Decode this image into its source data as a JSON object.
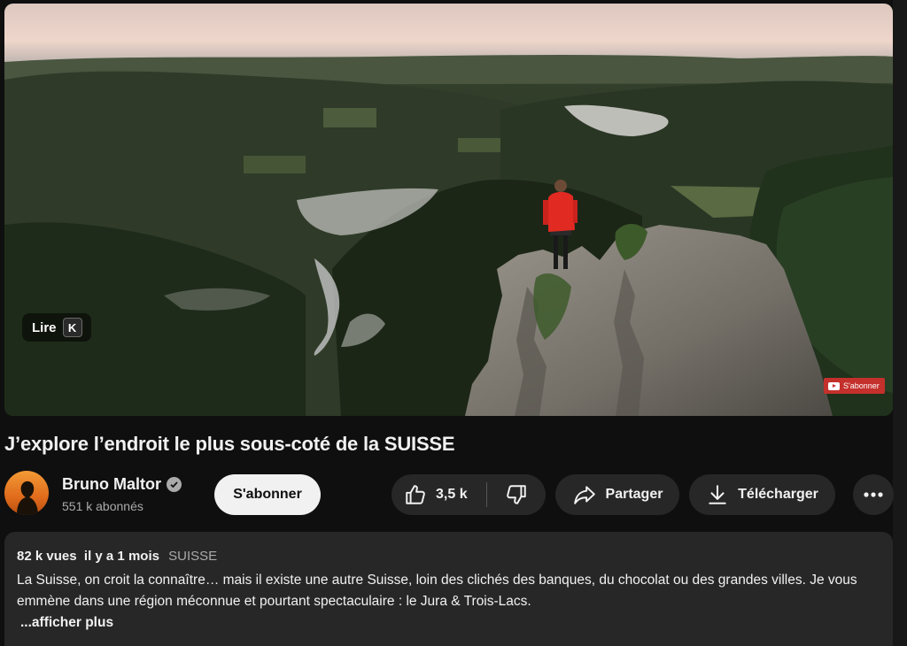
{
  "player": {
    "play_label": "Lire",
    "play_shortcut": "K",
    "watermark_label": "S'abonner"
  },
  "video": {
    "title": "J’explore l’endroit le plus sous-coté de la SUISSE"
  },
  "channel": {
    "name": "Bruno Maltor",
    "subscribers": "551 k abonnés",
    "verified_icon": "check-circle-icon",
    "subscribe_label": "S'abonner"
  },
  "actions": {
    "like_count": "3,5 k",
    "share_label": "Partager",
    "download_label": "Télécharger",
    "more_icon": "more-horizontal-icon"
  },
  "description": {
    "views": "82 k vues",
    "date": "il y a 1 mois",
    "tag": "SUISSE",
    "text": "La Suisse, on croit la connaître… mais il existe une autre Suisse, loin des clichés des banques, du chocolat ou des grandes villes. Je vous emmène dans une région méconnue et pourtant spectaculaire : le Jura & Trois-Lacs.",
    "show_more": "...afficher plus"
  },
  "colors": {
    "background": "#0f0f0f",
    "surface": "#272727",
    "text_secondary": "#aaaaaa",
    "subscribe_bg": "#f1f1f1",
    "jacket_red": "#e02a22"
  }
}
